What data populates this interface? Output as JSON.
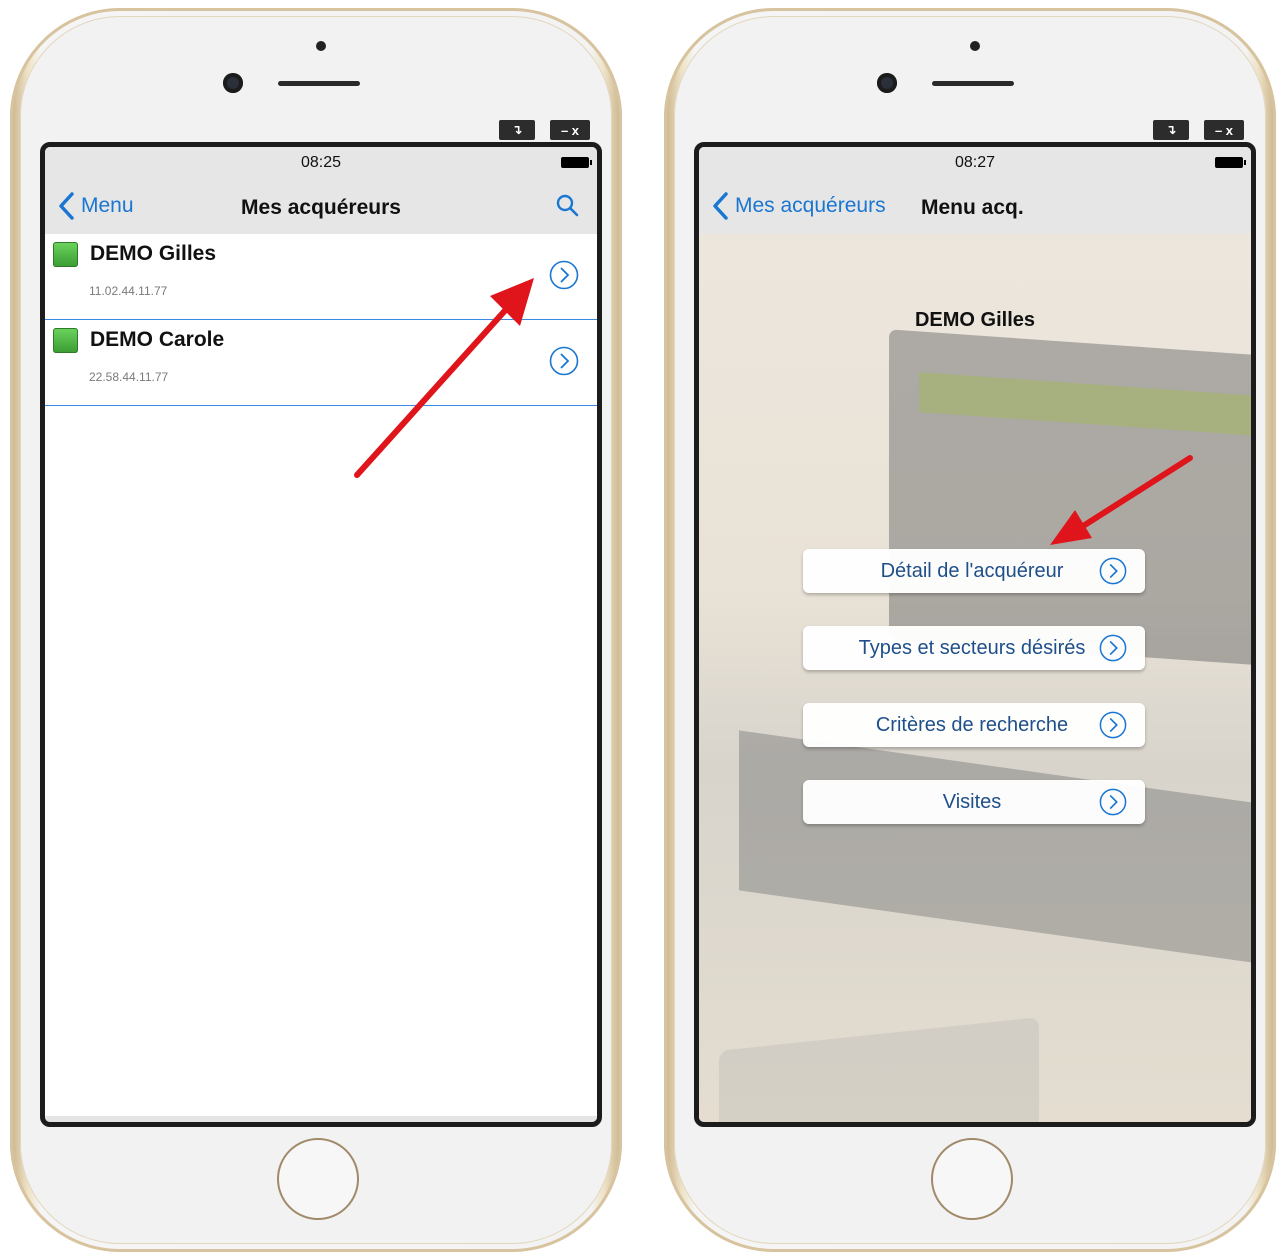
{
  "left_phone": {
    "window_controls": {
      "restore": "↴",
      "minimize_close": "– x"
    },
    "status_bar": {
      "time": "08:25"
    },
    "nav": {
      "back_label": "Menu",
      "title": "Mes acquéreurs",
      "search_icon": "search-icon"
    },
    "list": [
      {
        "name": "DEMO Gilles",
        "subtitle": "11.02.44.11.77",
        "status_color": "#4cb944"
      },
      {
        "name": "DEMO Carole",
        "subtitle": "22.58.44.11.77",
        "status_color": "#4cb944"
      }
    ]
  },
  "right_phone": {
    "window_controls": {
      "restore": "↴",
      "minimize_close": "– x"
    },
    "status_bar": {
      "time": "08:27"
    },
    "nav": {
      "back_label": "Mes acquéreurs",
      "title": "Menu acq."
    },
    "content_title": "DEMO Gilles",
    "menu": [
      {
        "label": "Détail de l'acquéreur"
      },
      {
        "label": "Types et secteurs désirés"
      },
      {
        "label": "Critères de recherche"
      },
      {
        "label": "Visites"
      }
    ]
  },
  "colors": {
    "accent": "#1976d2",
    "annotation_arrow": "#e0141b",
    "status_green": "#4cb944"
  }
}
